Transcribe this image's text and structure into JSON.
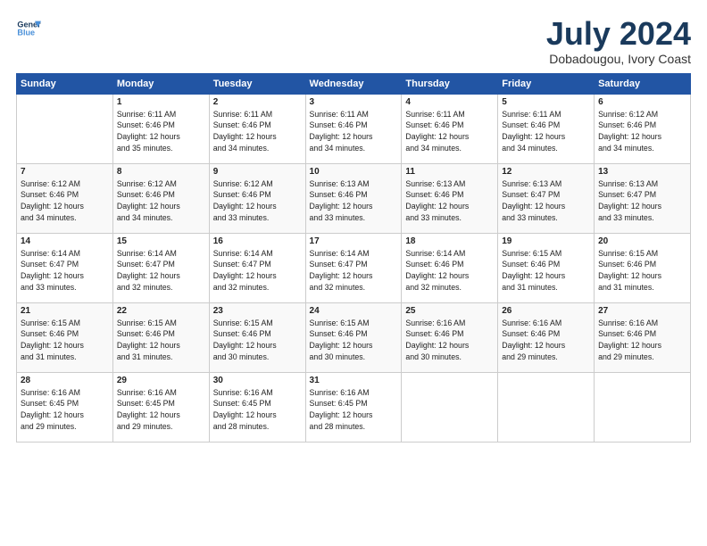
{
  "logo": {
    "line1": "General",
    "line2": "Blue"
  },
  "title": "July 2024",
  "subtitle": "Dobadougou, Ivory Coast",
  "header_days": [
    "Sunday",
    "Monday",
    "Tuesday",
    "Wednesday",
    "Thursday",
    "Friday",
    "Saturday"
  ],
  "weeks": [
    [
      {
        "day": "",
        "info": ""
      },
      {
        "day": "1",
        "info": "Sunrise: 6:11 AM\nSunset: 6:46 PM\nDaylight: 12 hours\nand 35 minutes."
      },
      {
        "day": "2",
        "info": "Sunrise: 6:11 AM\nSunset: 6:46 PM\nDaylight: 12 hours\nand 34 minutes."
      },
      {
        "day": "3",
        "info": "Sunrise: 6:11 AM\nSunset: 6:46 PM\nDaylight: 12 hours\nand 34 minutes."
      },
      {
        "day": "4",
        "info": "Sunrise: 6:11 AM\nSunset: 6:46 PM\nDaylight: 12 hours\nand 34 minutes."
      },
      {
        "day": "5",
        "info": "Sunrise: 6:11 AM\nSunset: 6:46 PM\nDaylight: 12 hours\nand 34 minutes."
      },
      {
        "day": "6",
        "info": "Sunrise: 6:12 AM\nSunset: 6:46 PM\nDaylight: 12 hours\nand 34 minutes."
      }
    ],
    [
      {
        "day": "7",
        "info": "Sunrise: 6:12 AM\nSunset: 6:46 PM\nDaylight: 12 hours\nand 34 minutes."
      },
      {
        "day": "8",
        "info": "Sunrise: 6:12 AM\nSunset: 6:46 PM\nDaylight: 12 hours\nand 34 minutes."
      },
      {
        "day": "9",
        "info": "Sunrise: 6:12 AM\nSunset: 6:46 PM\nDaylight: 12 hours\nand 33 minutes."
      },
      {
        "day": "10",
        "info": "Sunrise: 6:13 AM\nSunset: 6:46 PM\nDaylight: 12 hours\nand 33 minutes."
      },
      {
        "day": "11",
        "info": "Sunrise: 6:13 AM\nSunset: 6:46 PM\nDaylight: 12 hours\nand 33 minutes."
      },
      {
        "day": "12",
        "info": "Sunrise: 6:13 AM\nSunset: 6:47 PM\nDaylight: 12 hours\nand 33 minutes."
      },
      {
        "day": "13",
        "info": "Sunrise: 6:13 AM\nSunset: 6:47 PM\nDaylight: 12 hours\nand 33 minutes."
      }
    ],
    [
      {
        "day": "14",
        "info": "Sunrise: 6:14 AM\nSunset: 6:47 PM\nDaylight: 12 hours\nand 33 minutes."
      },
      {
        "day": "15",
        "info": "Sunrise: 6:14 AM\nSunset: 6:47 PM\nDaylight: 12 hours\nand 32 minutes."
      },
      {
        "day": "16",
        "info": "Sunrise: 6:14 AM\nSunset: 6:47 PM\nDaylight: 12 hours\nand 32 minutes."
      },
      {
        "day": "17",
        "info": "Sunrise: 6:14 AM\nSunset: 6:47 PM\nDaylight: 12 hours\nand 32 minutes."
      },
      {
        "day": "18",
        "info": "Sunrise: 6:14 AM\nSunset: 6:46 PM\nDaylight: 12 hours\nand 32 minutes."
      },
      {
        "day": "19",
        "info": "Sunrise: 6:15 AM\nSunset: 6:46 PM\nDaylight: 12 hours\nand 31 minutes."
      },
      {
        "day": "20",
        "info": "Sunrise: 6:15 AM\nSunset: 6:46 PM\nDaylight: 12 hours\nand 31 minutes."
      }
    ],
    [
      {
        "day": "21",
        "info": "Sunrise: 6:15 AM\nSunset: 6:46 PM\nDaylight: 12 hours\nand 31 minutes."
      },
      {
        "day": "22",
        "info": "Sunrise: 6:15 AM\nSunset: 6:46 PM\nDaylight: 12 hours\nand 31 minutes."
      },
      {
        "day": "23",
        "info": "Sunrise: 6:15 AM\nSunset: 6:46 PM\nDaylight: 12 hours\nand 30 minutes."
      },
      {
        "day": "24",
        "info": "Sunrise: 6:15 AM\nSunset: 6:46 PM\nDaylight: 12 hours\nand 30 minutes."
      },
      {
        "day": "25",
        "info": "Sunrise: 6:16 AM\nSunset: 6:46 PM\nDaylight: 12 hours\nand 30 minutes."
      },
      {
        "day": "26",
        "info": "Sunrise: 6:16 AM\nSunset: 6:46 PM\nDaylight: 12 hours\nand 29 minutes."
      },
      {
        "day": "27",
        "info": "Sunrise: 6:16 AM\nSunset: 6:46 PM\nDaylight: 12 hours\nand 29 minutes."
      }
    ],
    [
      {
        "day": "28",
        "info": "Sunrise: 6:16 AM\nSunset: 6:45 PM\nDaylight: 12 hours\nand 29 minutes."
      },
      {
        "day": "29",
        "info": "Sunrise: 6:16 AM\nSunset: 6:45 PM\nDaylight: 12 hours\nand 29 minutes."
      },
      {
        "day": "30",
        "info": "Sunrise: 6:16 AM\nSunset: 6:45 PM\nDaylight: 12 hours\nand 28 minutes."
      },
      {
        "day": "31",
        "info": "Sunrise: 6:16 AM\nSunset: 6:45 PM\nDaylight: 12 hours\nand 28 minutes."
      },
      {
        "day": "",
        "info": ""
      },
      {
        "day": "",
        "info": ""
      },
      {
        "day": "",
        "info": ""
      }
    ]
  ]
}
